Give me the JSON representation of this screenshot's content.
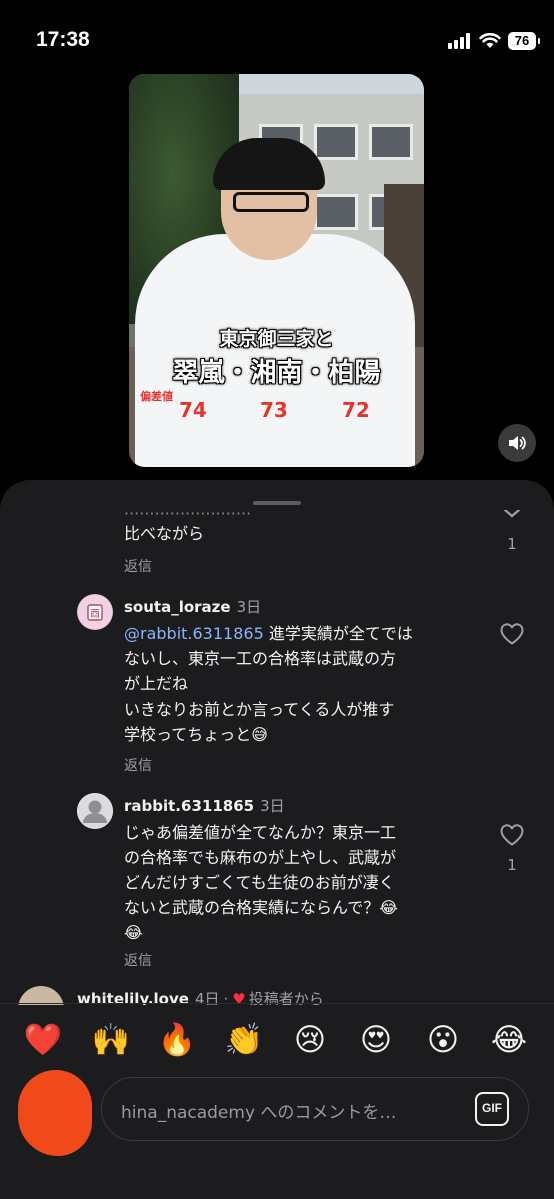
{
  "status_bar": {
    "time": "17:38",
    "battery": "76"
  },
  "video": {
    "caption_line1": "東京御三家と",
    "caption_line2": "翠嵐・湘南・柏陽",
    "deviation_label": "偏差値",
    "scores": [
      "74",
      "73",
      "72"
    ]
  },
  "comments": {
    "partial": {
      "line": "比べながら",
      "reply": "返信",
      "likes": "1"
    },
    "items": [
      {
        "username": "souta_loraze",
        "ago": "3日",
        "mention": "@rabbit.6311865",
        "lines": [
          "進学実績が全てでは",
          "ないし、東京一工の合格率は武蔵の方",
          "が上だね",
          "いきなりお前とか言ってくる人が推す",
          "学校ってちょっと😅"
        ],
        "reply": "返信"
      },
      {
        "username": "rabbit.6311865",
        "ago": "3日",
        "lines": [
          "じゃあ偏差値が全てなんか？東京一工",
          "の合格率でも麻布のが上やし、武蔵が",
          "どんだけすごくても生徒のお前が凄く",
          "ないと武蔵の合格実績にならんで？😂",
          "😂"
        ],
        "reply": "返信",
        "likes": "1"
      },
      {
        "username": "whitelily.love",
        "ago": "4日",
        "author_badge": "投稿者から"
      }
    ]
  },
  "emoji_bar": [
    "❤️",
    "🙌",
    "🔥",
    "👏",
    "😢",
    "😍",
    "😮",
    "😂"
  ],
  "input": {
    "placeholder": "hina_nacademy へのコメントを…",
    "gif_label": "GIF"
  }
}
